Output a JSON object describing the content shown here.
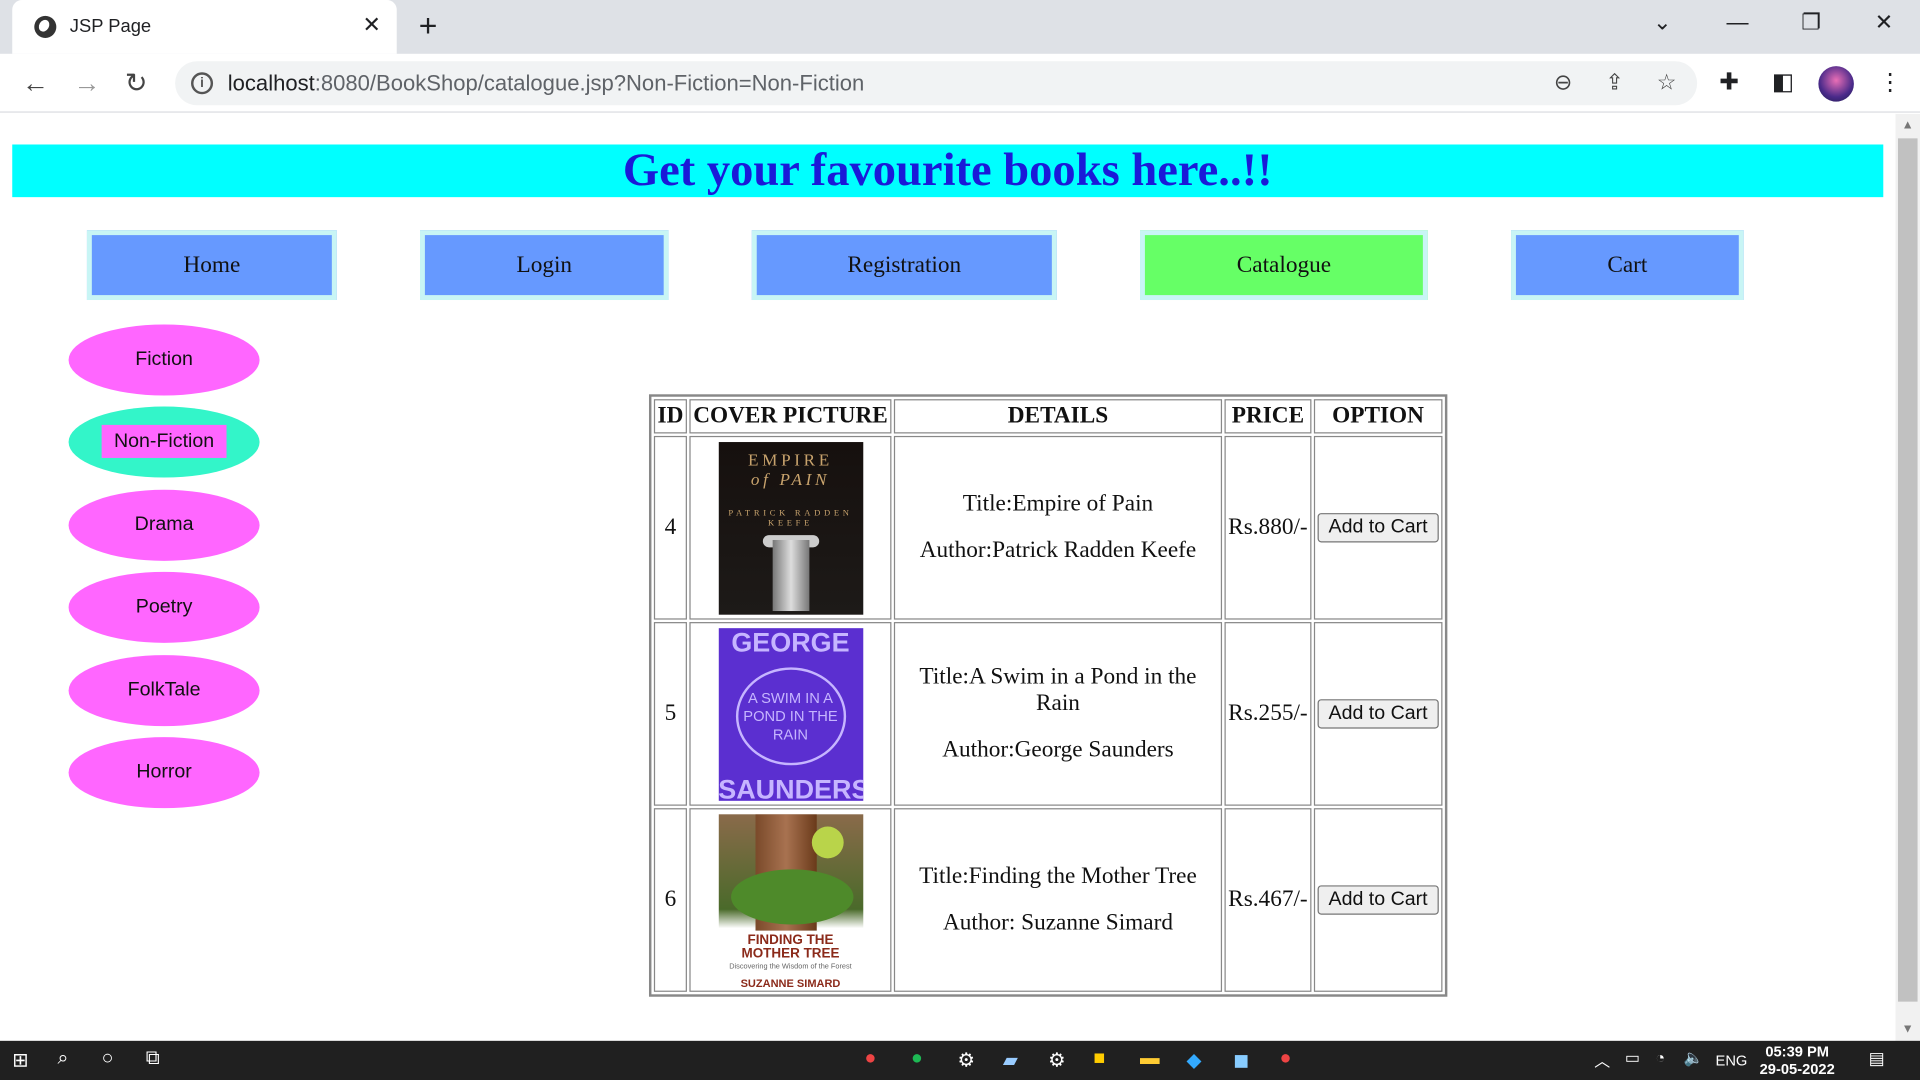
{
  "browser": {
    "tab_title": "JSP Page",
    "url_host": "localhost",
    "url_path": ":8080/BookShop/catalogue.jsp?Non-Fiction=Non-Fiction"
  },
  "banner": "Get your favourite books here..!!",
  "nav": [
    {
      "label": "Home"
    },
    {
      "label": "Login"
    },
    {
      "label": "Registration"
    },
    {
      "label": "Catalogue"
    },
    {
      "label": "Cart"
    }
  ],
  "categories": [
    {
      "label": "Fiction"
    },
    {
      "label": "Non-Fiction"
    },
    {
      "label": "Drama"
    },
    {
      "label": "Poetry"
    },
    {
      "label": "FolkTale"
    },
    {
      "label": "Horror"
    }
  ],
  "table": {
    "headers": [
      "ID",
      "COVER PICTURE",
      "DETAILS",
      "PRICE",
      "OPTION"
    ],
    "rows": [
      {
        "id": "4",
        "title": "Title:Empire of Pain",
        "author": "Author:Patrick Radden Keefe",
        "price": "Rs.880/-",
        "button": "Add to Cart",
        "cover": {
          "l1": "EMPIRE",
          "l2": "of PAIN",
          "l3": "PATRICK RADDEN KEEFE"
        }
      },
      {
        "id": "5",
        "title": "Title:A Swim in a Pond in the Rain",
        "author": "Author:George Saunders",
        "price": "Rs.255/-",
        "button": "Add to Cart",
        "cover": {
          "l1": "GEORGE",
          "l2": "A SWIM IN A POND IN THE RAIN",
          "l3": "SAUNDERS"
        }
      },
      {
        "id": "6",
        "title": "Title:Finding the Mother Tree",
        "author": "Author: Suzanne Simard",
        "price": "Rs.467/-",
        "button": "Add to Cart",
        "cover": {
          "l1": "FINDING THE MOTHER TREE",
          "l2": "Discovering the Wisdom of the Forest",
          "l3": "SUZANNE SIMARD"
        }
      }
    ]
  },
  "taskbar": {
    "lang": "ENG",
    "time": "05:39 PM",
    "date": "29-05-2022"
  },
  "colors": {
    "banner_bg": "#00ffff",
    "banner_text": "#1a1ad8",
    "nav_bg": "#6699ff",
    "nav_active": "#66ff66",
    "pill_bg": "#ff66ff",
    "pill_active": "#33f5c9"
  }
}
